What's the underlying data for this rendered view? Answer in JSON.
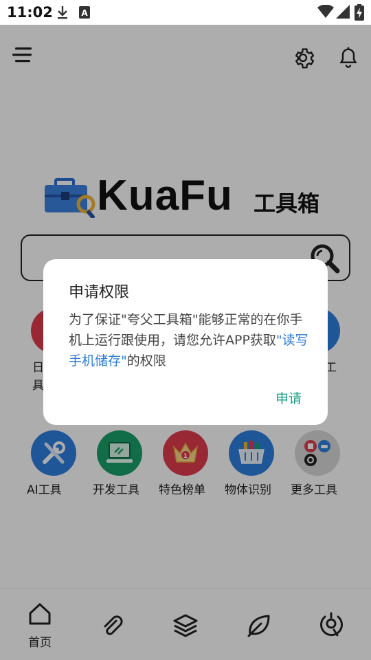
{
  "status_bar": {
    "time": "11:02",
    "icons": [
      "download-icon",
      "a-badge-icon",
      "wifi-icon",
      "signal-icon",
      "battery-charging-icon"
    ]
  },
  "top_bar": {
    "menu_icon": "menu-icon",
    "settings_icon": "gear-icon",
    "notifications_icon": "bell-icon"
  },
  "logo": {
    "word": "KuaFu",
    "suffix": "工具箱"
  },
  "search": {
    "value": "",
    "button_icon": "search-icon"
  },
  "grid_partial": {
    "left_label": "日具",
    "right_label": "工"
  },
  "grid": [
    {
      "label": "AI工具",
      "icon": "tools-icon",
      "color": "#2f7fe0"
    },
    {
      "label": "开发工具",
      "icon": "laptop-icon",
      "color": "#1aa06b"
    },
    {
      "label": "特色榜单",
      "icon": "crown-icon",
      "color": "#e23b4e"
    },
    {
      "label": "物体识别",
      "icon": "basket-icon",
      "color": "#2f7fe0"
    },
    {
      "label": "更多工具",
      "icon": "more-apps-icon",
      "color": "#d9d9d9"
    }
  ],
  "bottom_nav": [
    {
      "label": "首页",
      "icon": "home-icon",
      "active": true
    },
    {
      "label": "",
      "icon": "paperclip-icon"
    },
    {
      "label": "",
      "icon": "layers-icon"
    },
    {
      "label": "",
      "icon": "leaf-icon"
    },
    {
      "label": "",
      "icon": "settings-app-icon"
    }
  ],
  "dialog": {
    "title": "申请权限",
    "body_prefix": "为了保证\"夸父工具箱\"能够正常的在你手机上运行跟使用，请您允许APP获取",
    "body_highlight": "\"读写手机储存\"",
    "body_suffix": "的权限",
    "button": "申请",
    "colors": {
      "highlight": "#2e7bd6",
      "button": "#18a089"
    }
  }
}
